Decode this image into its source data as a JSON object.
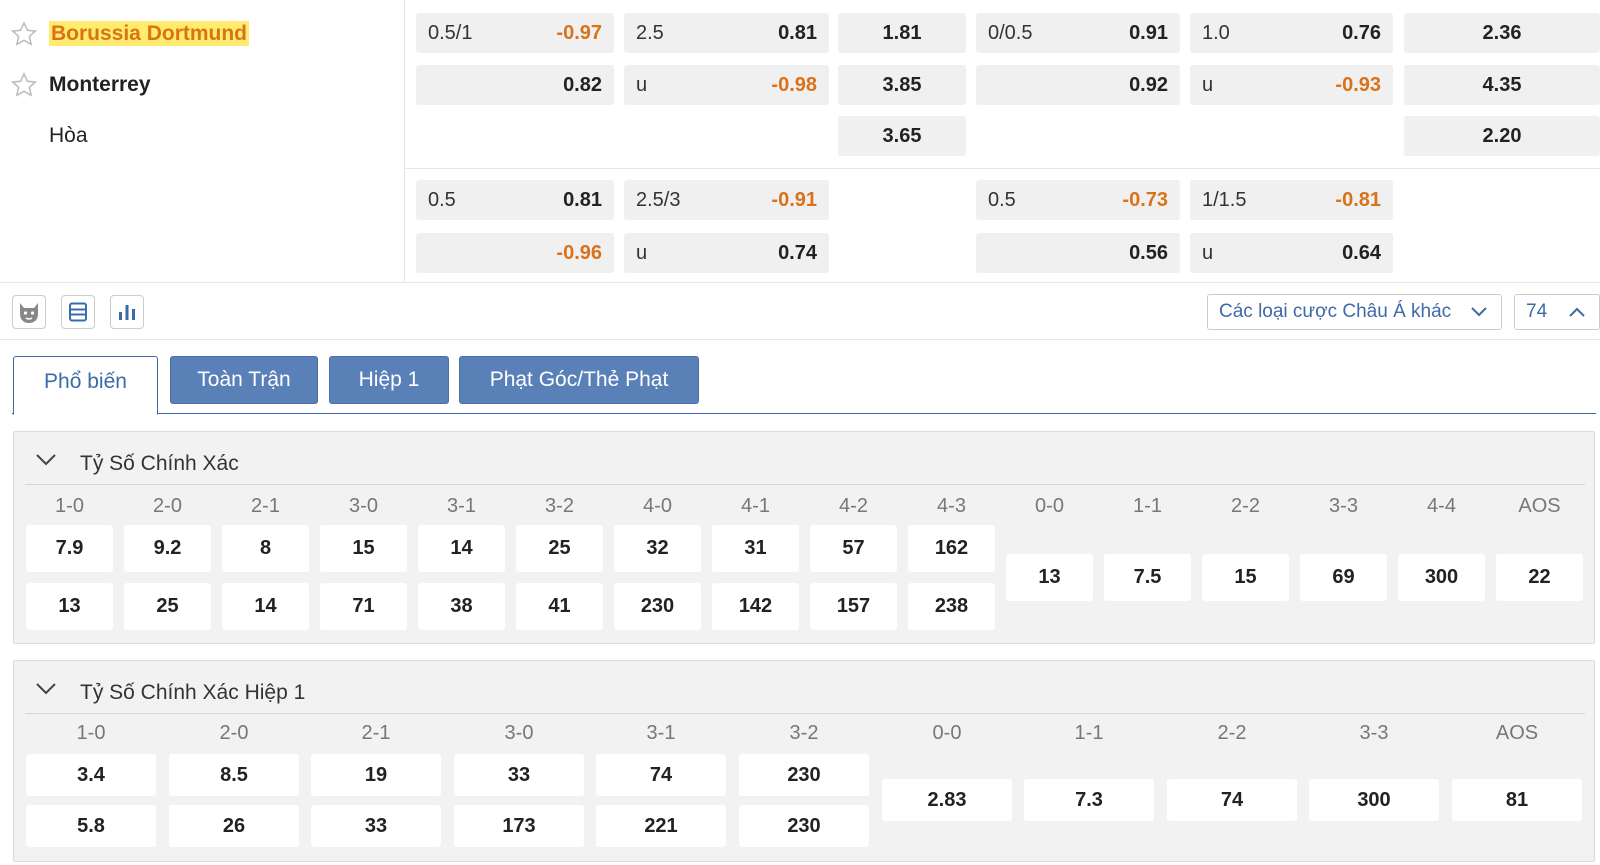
{
  "match": {
    "home": "Borussia Dortmund",
    "away": "Monterrey",
    "draw": "Hòa"
  },
  "odds_main": [
    {
      "line": "0.5/1",
      "home": "-0.97",
      "away": "0.82"
    },
    {
      "line": "2.5",
      "over": "0.81",
      "u_label": "u",
      "under": "-0.98"
    },
    {
      "home": "1.81",
      "away": "3.85",
      "draw": "3.65"
    },
    {
      "line": "0/0.5",
      "home": "0.91",
      "away": "0.92"
    },
    {
      "line": "1.0",
      "over": "0.76",
      "u_label": "u",
      "under": "-0.93"
    },
    {
      "home": "2.36",
      "away": "4.35",
      "draw": "2.20"
    }
  ],
  "odds_alt": [
    {
      "line": "0.5",
      "home": "0.81",
      "away": "-0.96"
    },
    {
      "line": "2.5/3",
      "over": "-0.91",
      "u_label": "u",
      "under": "0.74"
    },
    {
      "line": "0.5",
      "home": "-0.73",
      "away": "0.56"
    },
    {
      "line": "1/1.5",
      "over": "-0.81",
      "u_label": "u",
      "under": "0.64"
    }
  ],
  "toolbar": {
    "bet_type_select": "Các loại cược Châu Á khác",
    "count_select": "74"
  },
  "tabs": [
    "Phổ biến",
    "Toàn Trận",
    "Hiệp 1",
    "Phạt Góc/Thẻ Phạt"
  ],
  "correct_score": {
    "title": "Tỷ Số Chính Xác",
    "headers": [
      "1-0",
      "2-0",
      "2-1",
      "3-0",
      "3-1",
      "3-2",
      "4-0",
      "4-1",
      "4-2",
      "4-3",
      "0-0",
      "1-1",
      "2-2",
      "3-3",
      "4-4",
      "AOS"
    ],
    "home": [
      "7.9",
      "9.2",
      "8",
      "15",
      "14",
      "25",
      "32",
      "31",
      "57",
      "162"
    ],
    "away": [
      "13",
      "25",
      "14",
      "71",
      "38",
      "41",
      "230",
      "142",
      "157",
      "238"
    ],
    "draws": [
      "13",
      "7.5",
      "15",
      "69",
      "300",
      "22"
    ]
  },
  "correct_score_h1": {
    "title": "Tỷ Số Chính Xác Hiệp 1",
    "headers": [
      "1-0",
      "2-0",
      "2-1",
      "3-0",
      "3-1",
      "3-2",
      "0-0",
      "1-1",
      "2-2",
      "3-3",
      "AOS"
    ],
    "home": [
      "3.4",
      "8.5",
      "19",
      "33",
      "74",
      "230"
    ],
    "away": [
      "5.8",
      "26",
      "33",
      "173",
      "221",
      "230"
    ],
    "draws": [
      "2.83",
      "7.3",
      "74",
      "300",
      "81"
    ]
  },
  "colors": {
    "accent": "#3d6aa8",
    "tab_bg": "#5a80b8",
    "negative": "#d9731a",
    "highlight": "#ffec6e"
  }
}
